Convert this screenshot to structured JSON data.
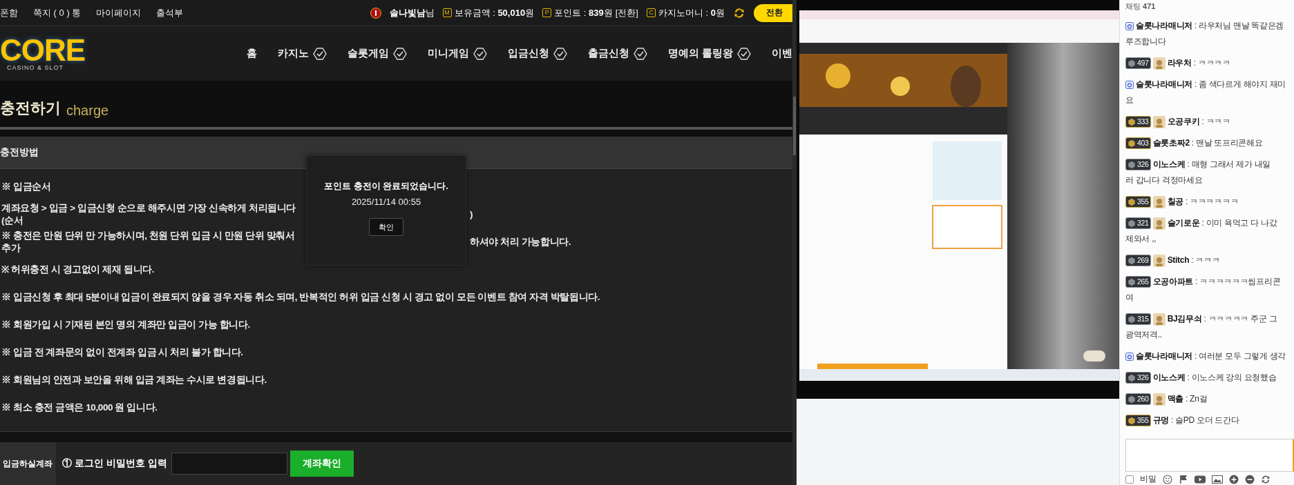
{
  "top_bar": {
    "links": [
      "폰함",
      "쪽지 ( 0 ) 통",
      "마이페이지",
      "출석부"
    ],
    "user": "**솔나빛남**님",
    "stats": [
      {
        "icon": "M",
        "text": "보유금액 : **50,010**원"
      },
      {
        "icon": "P",
        "text": "포인트 : **839**원",
        "link": "[전환]"
      },
      {
        "icon": "C",
        "text": "카지노머니 : **0**원"
      }
    ],
    "button": "전환"
  },
  "nav": {
    "logo": "CORE",
    "tagline": "CASINO & SLOT",
    "items": [
      {
        "label": "홈",
        "check": false
      },
      {
        "label": "카지노",
        "check": true
      },
      {
        "label": "슬롯게임",
        "check": true
      },
      {
        "label": "미니게임",
        "check": true
      },
      {
        "label": "입금신청",
        "check": true
      },
      {
        "label": "출금신청",
        "check": true
      },
      {
        "label": "명예의 롤링왕",
        "check": true
      },
      {
        "label": "이벤",
        "check": false
      }
    ]
  },
  "page": {
    "title": "충전하기",
    "subtitle": "charge"
  },
  "section": {
    "title": "충전방법",
    "lines": [
      {
        "text": "※ 입금순서"
      },
      {
        "text": "**계좌요청 > 입금 > 입금신청** 순으로 해주시면 가장 신속하게 처리됩니다 (순서",
        "after": ")"
      },
      {
        "text": "※ 충전은 **만원 단위** 만 가능하시며, **천원 단위** 입금 시 **만원 단위 맞춰서 추가**",
        "after": "하셔야 처리 가능합니다."
      },
      {
        "text": "※ **허위충전** 시 경고없이 제재 됩니다."
      },
      {
        "text": "※ 입금신청 후 최대 5분이내 입금이 완료되지 않을 경우 자동 취소 되며, **반복적인 허위 입금 신청 시 경고 없이 모든 이벤트 참여 자격 박탈**됩니다."
      },
      {
        "text": "※ 회원가입 시 기재된 **본인 명의 계좌만 입금이 가능** 합니다."
      },
      {
        "text": "※ 입금 전 계좌문의 없이 전계좌 입금 시 처리 불가 합니다."
      },
      {
        "text": "※ 회원님의 안전과 보안을 위해 입금 계좌는 수시로 변경됩니다."
      },
      {
        "text": "※ 최소 충전 금액은 **10,000 원** 입니다."
      }
    ]
  },
  "modal": {
    "message": "포인트 충전이 완료되었습니다.",
    "time": "2025/11/14 00:55",
    "button": "확인"
  },
  "account_form": {
    "label": "입금하실계좌",
    "field_label": "① 로그인 비밀번호 입력",
    "button": "계좌확인"
  },
  "chat": {
    "title": "채팅 **471**",
    "messages": [
      {
        "kind": "manager",
        "name": "슬롯나라매니저",
        "lines": [
          ": 라우처님 맨날 똑같은겜",
          "루즈합니다"
        ]
      },
      {
        "kind": "user",
        "level": "497",
        "color": "#8a8f96",
        "avatar": true,
        "name": "라우처",
        "lines": [
          ": ㅋㅋㅋㅋ"
        ]
      },
      {
        "kind": "manager",
        "name": "슬롯나라매니저",
        "lines": [
          ": 좀 색다르게 해야지 재미",
          "요"
        ]
      },
      {
        "kind": "user",
        "level": "333",
        "color": "#c9a33a",
        "avatar": true,
        "name": "오공쿠키",
        "lines": [
          ": ㅋㅋㅋ"
        ]
      },
      {
        "kind": "user",
        "level": "403",
        "color": "#c9a33a",
        "avatar": false,
        "name": "슬롯초짜2",
        "lines": [
          ": 맨날 또프리콘해요"
        ]
      },
      {
        "kind": "user",
        "level": "326",
        "color": "#8a8f96",
        "avatar": false,
        "name": "이노스케",
        "lines": [
          ": 매형 그래서 제가 내일",
          "러 갑니다 걱정마세요"
        ]
      },
      {
        "kind": "user",
        "level": "355",
        "color": "#c9a33a",
        "avatar": true,
        "name": "칠공",
        "lines": [
          ": ㅋㅋㅋㅋㅋㅋ"
        ]
      },
      {
        "kind": "user",
        "level": "321",
        "color": "#8a8f96",
        "avatar": true,
        "name": "슬기로운",
        "lines": [
          ": 이미 욕먹고 다 나갔",
          "제와서 ,,"
        ]
      },
      {
        "kind": "user",
        "level": "269",
        "color": "#8a8f96",
        "avatar": true,
        "name": "Stitch",
        "lines": [
          ": ㅋㅋㅋ"
        ]
      },
      {
        "kind": "user",
        "level": "265",
        "color": "#8a8f96",
        "avatar": false,
        "name": "오공아파트",
        "lines": [
          ": ㅋㅋㅋㅋㅋㅋ씹프리콘",
          "여"
        ]
      },
      {
        "kind": "user",
        "level": "315",
        "color": "#8a8f96",
        "avatar": true,
        "name": "BJ김무쇠",
        "lines": [
          ": ㅋㅋㅋㅋㅋ 주군 그",
          "광역저격.."
        ]
      },
      {
        "kind": "manager",
        "name": "슬롯나라매니저",
        "lines": [
          ": 여러분 모두 그렇게 생각"
        ]
      },
      {
        "kind": "user",
        "level": "326",
        "color": "#8a8f96",
        "avatar": false,
        "name": "이노스케",
        "lines": [
          ": 이노스케 강의 요청했습"
        ]
      },
      {
        "kind": "user",
        "level": "260",
        "color": "#8a8f96",
        "avatar": true,
        "name": "맥출",
        "lines": [
          ": Zn걸"
        ]
      },
      {
        "kind": "user",
        "level": "355",
        "color": "#c9a33a",
        "avatar": false,
        "name": "규멍",
        "lines": [
          ": 슬PD 오더 드간다"
        ]
      }
    ],
    "secret": {
      "label": "비밀",
      "checked": false
    }
  }
}
